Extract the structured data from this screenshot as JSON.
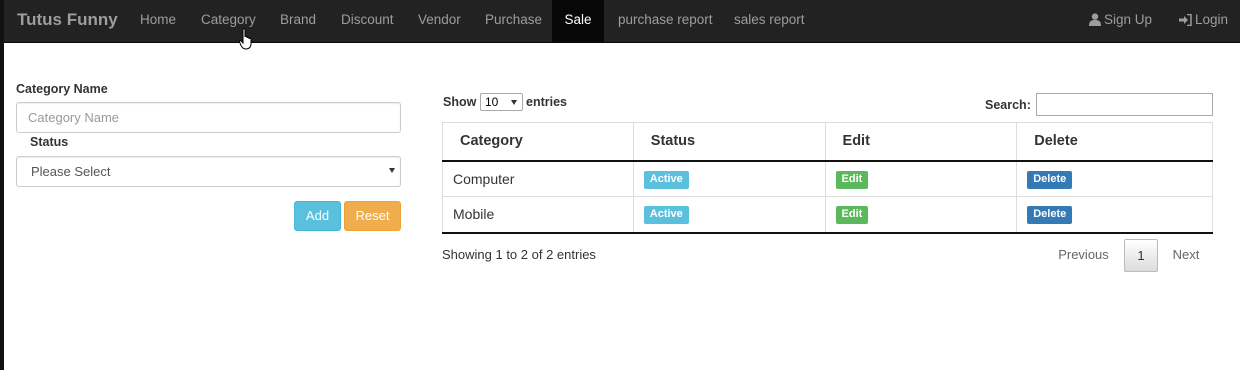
{
  "navbar": {
    "brand": "Tutus Funny",
    "items": [
      {
        "label": "Home"
      },
      {
        "label": "Category"
      },
      {
        "label": "Brand"
      },
      {
        "label": "Discount"
      },
      {
        "label": "Vendor"
      },
      {
        "label": "Purchase"
      },
      {
        "label": "Sale",
        "active": true
      },
      {
        "label": "purchase report"
      },
      {
        "label": "sales report"
      }
    ],
    "signup": {
      "label": "Sign Up",
      "icon": "user-icon"
    },
    "login": {
      "label": "Login",
      "icon": "login-icon"
    }
  },
  "form": {
    "category_label": "Category Name",
    "category_placeholder": "Category Name",
    "category_value": "",
    "status_label": "Status",
    "status_selected": "Please Select",
    "add_label": "Add",
    "reset_label": "Reset"
  },
  "table": {
    "show_label": "Show",
    "length_value": "10",
    "entries_label": "entries",
    "search_label": "Search:",
    "search_value": "",
    "columns": [
      "Category",
      "Status",
      "Edit",
      "Delete"
    ],
    "rows": [
      {
        "category": "Computer",
        "status": "Active",
        "edit": "Edit",
        "delete": "Delete"
      },
      {
        "category": "Mobile",
        "status": "Active",
        "edit": "Edit",
        "delete": "Delete"
      }
    ],
    "info": "Showing 1 to 2 of 2 entries",
    "pagination": {
      "previous": "Previous",
      "current": "1",
      "next": "Next"
    }
  },
  "colors": {
    "navbar_bg": "#222222",
    "active_bg": "#080808",
    "info": "#5bc0de",
    "warning": "#f0ad4e",
    "success": "#5cb85c",
    "primary": "#337ab7"
  }
}
